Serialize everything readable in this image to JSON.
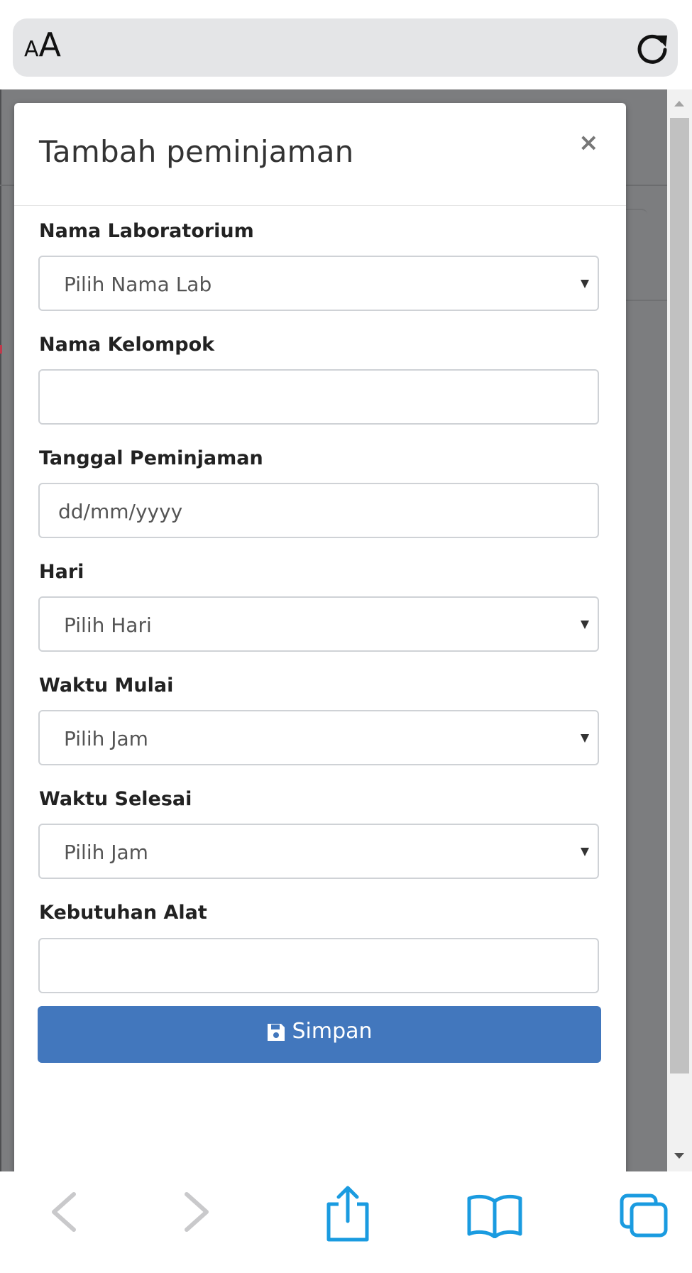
{
  "browser": {
    "text_size_button": "AA",
    "reload_icon": "reload-icon"
  },
  "modal": {
    "title": "Tambah peminjaman",
    "close_label": "×",
    "fields": [
      {
        "label": "Nama Laboratorium",
        "type": "select",
        "value": "Pilih Nama Lab"
      },
      {
        "label": "Nama Kelompok",
        "type": "text",
        "value": ""
      },
      {
        "label": "Tanggal Peminjaman",
        "type": "date",
        "placeholder": "dd/mm/yyyy"
      },
      {
        "label": "Hari",
        "type": "select",
        "value": "Pilih Hari"
      },
      {
        "label": "Waktu Mulai",
        "type": "select",
        "value": "Pilih Jam"
      },
      {
        "label": "Waktu Selesai",
        "type": "select",
        "value": "Pilih Jam"
      },
      {
        "label": "Kebutuhan Alat",
        "type": "text",
        "value": ""
      }
    ],
    "save_label": "Simpan",
    "save_icon": "floppy-disk-icon"
  },
  "toolbar": {
    "items": [
      "back-icon",
      "forward-icon",
      "share-icon",
      "bookmarks-icon",
      "tabs-icon"
    ]
  },
  "colors": {
    "primary_button": "#4277bd",
    "overlay": "#7c7d7f",
    "safari_blue": "#1a9be0"
  }
}
